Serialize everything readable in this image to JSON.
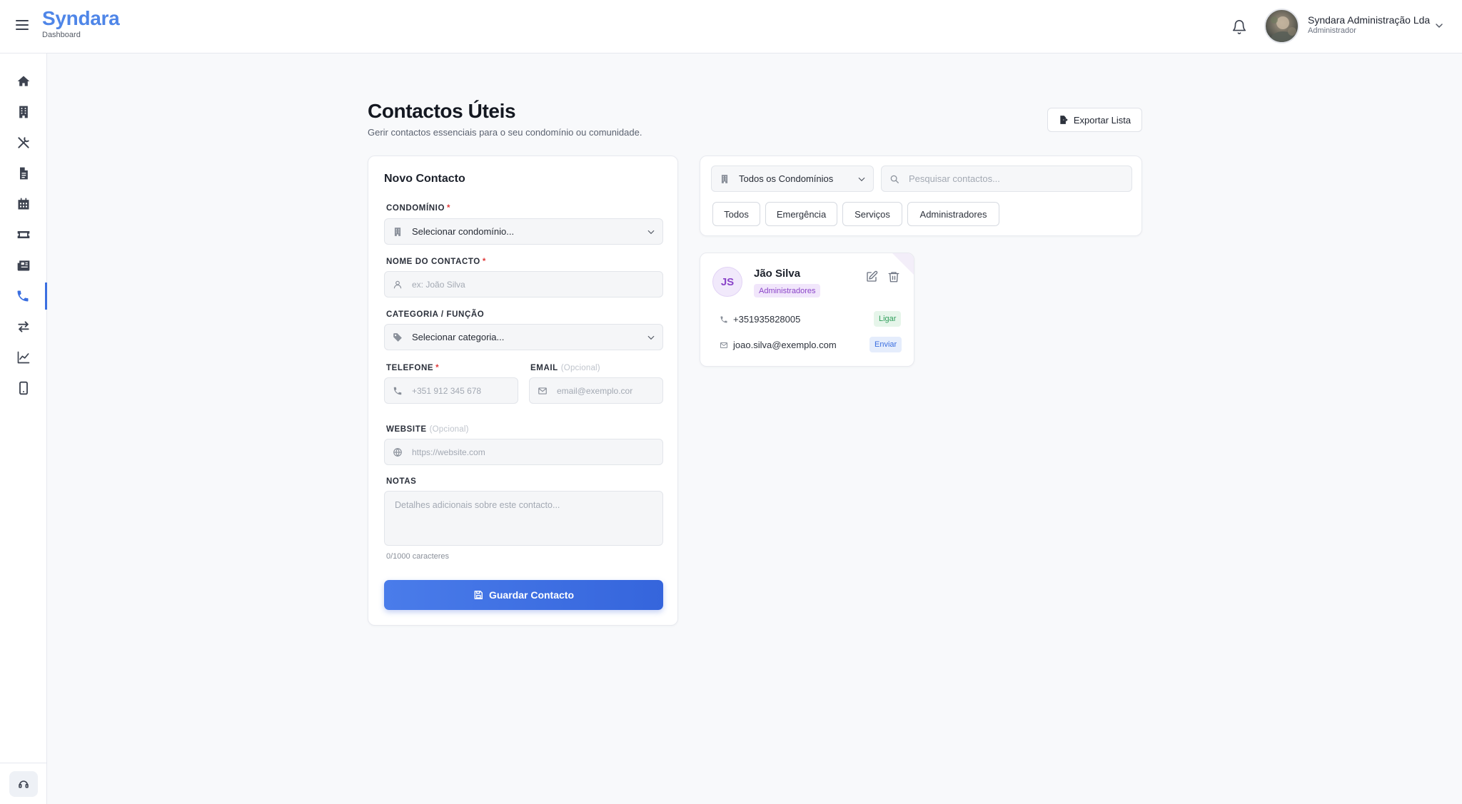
{
  "header": {
    "brand": "Syndara",
    "brand_sub": "Dashboard",
    "user_name": "Syndara Administração Lda",
    "user_role": "Administrador"
  },
  "sidebar": {
    "items": [
      {
        "icon": "home-icon"
      },
      {
        "icon": "building-icon"
      },
      {
        "icon": "tools-icon"
      },
      {
        "icon": "document-icon"
      },
      {
        "icon": "calendar-icon"
      },
      {
        "icon": "ticket-icon"
      },
      {
        "icon": "news-icon"
      },
      {
        "icon": "phone-icon",
        "active": true
      },
      {
        "icon": "exchange-icon"
      },
      {
        "icon": "chart-line-icon"
      },
      {
        "icon": "mobile-icon"
      }
    ],
    "bottom_icon": "support-icon"
  },
  "page": {
    "title": "Contactos Úteis",
    "subtitle": "Gerir contactos essenciais para o seu condomínio ou comunidade.",
    "export_label": "Exportar Lista"
  },
  "form": {
    "title": "Novo Contacto",
    "condominio_label": "CONDOMÍNIO",
    "condominio_value": "Selecionar condomínio...",
    "nome_label": "NOME DO CONTACTO",
    "nome_placeholder": "ex: João Silva",
    "categoria_label": "CATEGORIA / FUNÇÃO",
    "categoria_value": "Selecionar categoria...",
    "telefone_label": "TELEFONE",
    "telefone_placeholder": "+351 912 345 678",
    "email_label": "EMAIL",
    "email_placeholder": "email@exemplo.cor",
    "optional": "(Opcional)",
    "website_label": "WEBSITE",
    "website_placeholder": "https://website.com",
    "notas_label": "NOTAS",
    "notas_placeholder": "Detalhes adicionais sobre este contacto...",
    "counter": "0/1000 caracteres",
    "required_mark": "*",
    "save_label": "Guardar Contacto"
  },
  "filters": {
    "condominio_value": "Todos os Condomínios",
    "search_placeholder": "Pesquisar contactos...",
    "chips": [
      "Todos",
      "Emergência",
      "Serviços",
      "Administradores"
    ]
  },
  "contacts": [
    {
      "initials": "JS",
      "name": "Jão Silva",
      "category": "Administradores",
      "phone": "+351935828005",
      "phone_action": "Ligar",
      "email": "joao.silva@exemplo.com",
      "email_action": "Enviar"
    }
  ],
  "colors": {
    "brand": "#4f86e8",
    "primary": "#3b6fe0",
    "required": "#e03b3b",
    "admin_badge": "#8a44c8",
    "call_green": "#2f9e5a",
    "send_blue": "#3b6fe0"
  }
}
